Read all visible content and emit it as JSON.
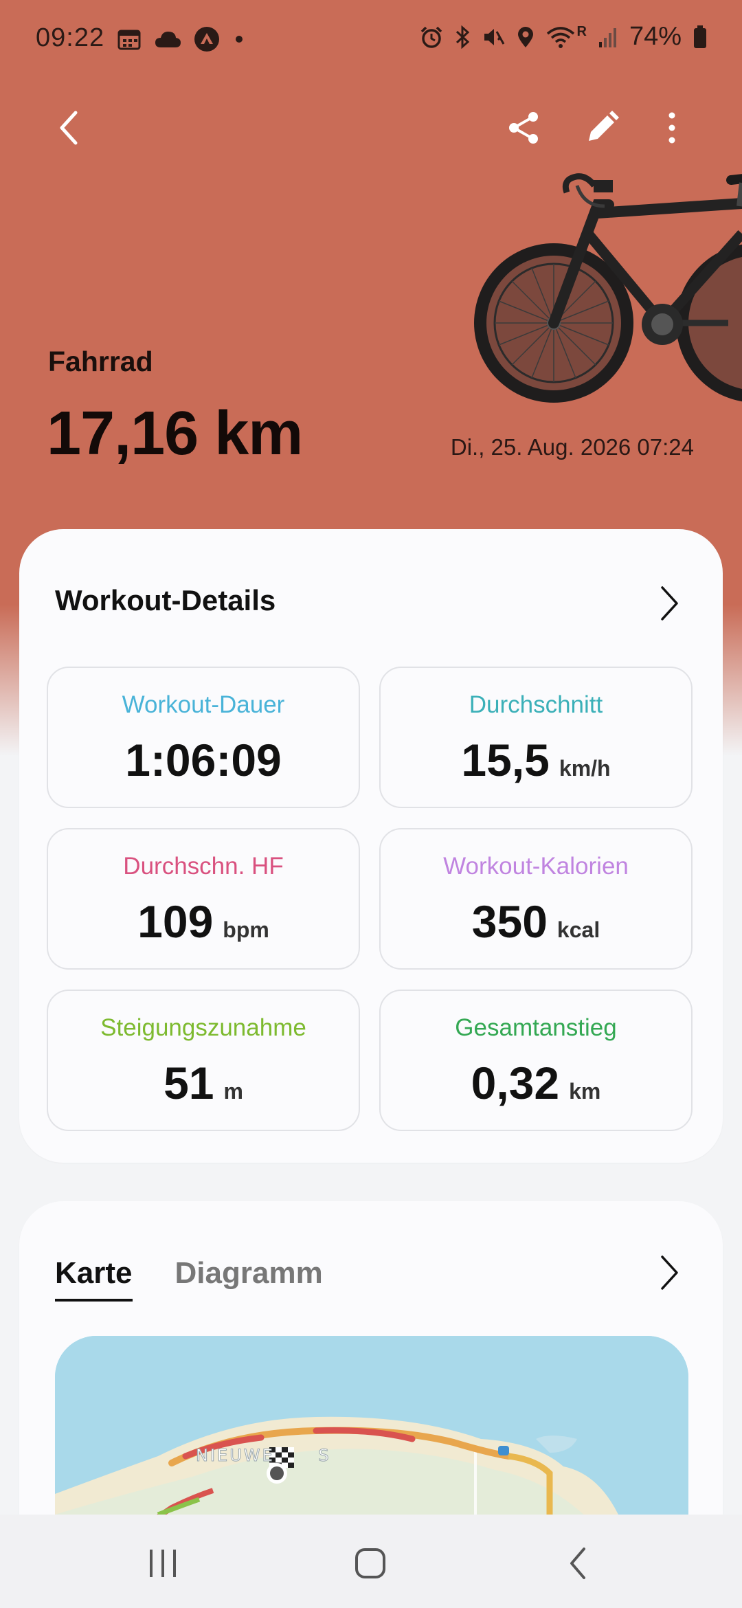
{
  "status_bar": {
    "time": "09:22",
    "battery": "74%",
    "network_tag": "R",
    "left_icons": [
      "calendar-icon",
      "cloud-icon",
      "strava-icon",
      "dot-icon"
    ],
    "right_icons": [
      "alarm-icon",
      "bluetooth-icon",
      "mute-icon",
      "location-icon",
      "wifi-icon",
      "signal-icon",
      "battery-icon"
    ]
  },
  "toolbar": {
    "back_icon": "chevron-left-icon",
    "share_icon": "share-icon",
    "edit_icon": "pencil-icon",
    "more_icon": "more-vertical-icon"
  },
  "activity": {
    "type": "Fahrrad",
    "distance": "17,16 km",
    "date": "Di., 25. Aug. 2026 07:24"
  },
  "details": {
    "title": "Workout-Details",
    "tiles": [
      {
        "label": "Workout-Dauer",
        "value": "1:06:09",
        "unit": "",
        "color": "#49b3d8"
      },
      {
        "label": "Durchschnitt",
        "value": "15,5",
        "unit": "km/h",
        "color": "#3bb0b8"
      },
      {
        "label": "Durchschn. HF",
        "value": "109",
        "unit": "bpm",
        "color": "#d9517f"
      },
      {
        "label": "Workout-Kalorien",
        "value": "350",
        "unit": "kcal",
        "color": "#c084e0"
      },
      {
        "label": "Steigungszunahme",
        "value": "51",
        "unit": "m",
        "color": "#7dba2f"
      },
      {
        "label": "Gesamtanstieg",
        "value": "0,32",
        "unit": "km",
        "color": "#34a853"
      }
    ]
  },
  "map_section": {
    "tabs": [
      {
        "label": "Karte",
        "active": true
      },
      {
        "label": "Diagramm",
        "active": false
      }
    ],
    "map_label": "NIEUWE      S"
  },
  "colors": {
    "hero": "#c96c57",
    "card": "#fbfbfd",
    "background": "#f3f4f6"
  },
  "navbar": {
    "recents_icon": "recents-icon",
    "home_icon": "home-icon",
    "back_icon": "nav-back-icon"
  }
}
